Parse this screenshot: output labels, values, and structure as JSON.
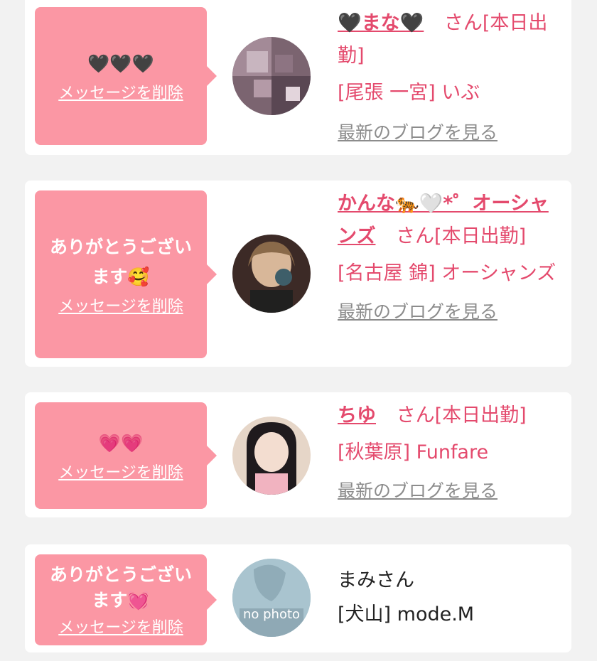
{
  "cards": [
    {
      "message": "🖤🖤🖤",
      "delete_label": "メッセージを削除",
      "name": "🖤まな🖤",
      "suffix": "さん[本日出勤]",
      "location": "[尾張 一宮] いぶ",
      "blog_link": "最新のブログを見る"
    },
    {
      "message": "ありがとうございます🥰",
      "delete_label": "メッセージを削除",
      "name": "かんな🐅🤍*゜オーシャンズ",
      "suffix": "さん[本日出勤]",
      "location": "[名古屋 錦] オーシャンズ",
      "blog_link": "最新のブログを見る"
    },
    {
      "message": "💗💗",
      "delete_label": "メッセージを削除",
      "name": "ちゆ",
      "suffix": "さん[本日出勤]",
      "location": "[秋葉原] Funfare",
      "blog_link": "最新のブログを見る"
    },
    {
      "message": "ありがとうございます💓",
      "delete_label": "メッセージを削除",
      "name": "まみさん",
      "location": "[犬山] mode.M",
      "avatar_text": "no photo"
    }
  ],
  "colors": {
    "bubble": "#fb97a4",
    "accent": "#e44a6d",
    "muted": "#8c8c8c"
  }
}
